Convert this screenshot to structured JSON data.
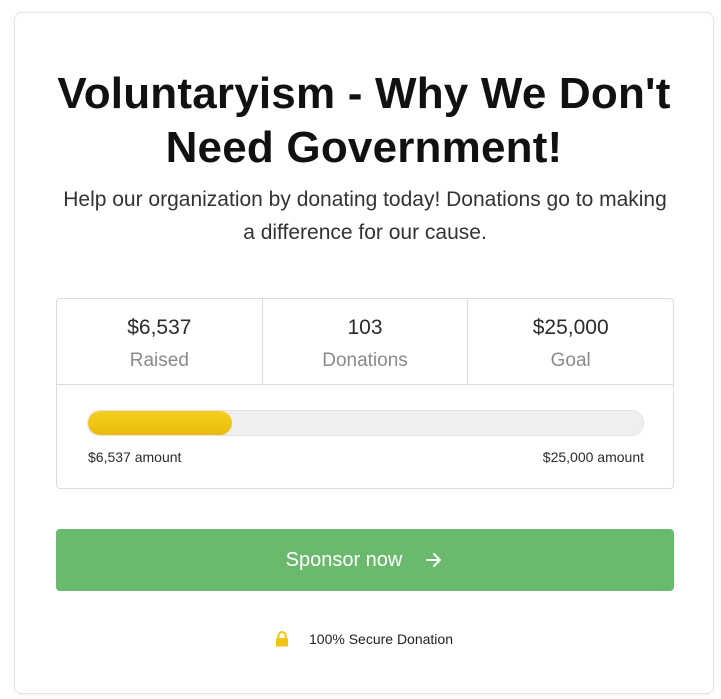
{
  "campaign": {
    "title": "Voluntaryism - Why We Don't Need Government!",
    "subtitle": "Help our organization by donating today! Donations go to making a difference for our cause."
  },
  "stats": [
    {
      "value": "$6,537",
      "label": "Raised"
    },
    {
      "value": "103",
      "label": "Donations"
    },
    {
      "value": "$25,000",
      "label": "Goal"
    }
  ],
  "progress": {
    "fraction": 0.26,
    "left_label": "$6,537 amount",
    "right_label": "$25,000 amount",
    "fill_color": "#f2c413"
  },
  "sponsor_button": {
    "label": "Sponsor now",
    "icon": "arrow-right-icon",
    "color": "#6ab96d"
  },
  "secure_note": {
    "icon": "lock-icon",
    "text": "100% Secure Donation"
  }
}
